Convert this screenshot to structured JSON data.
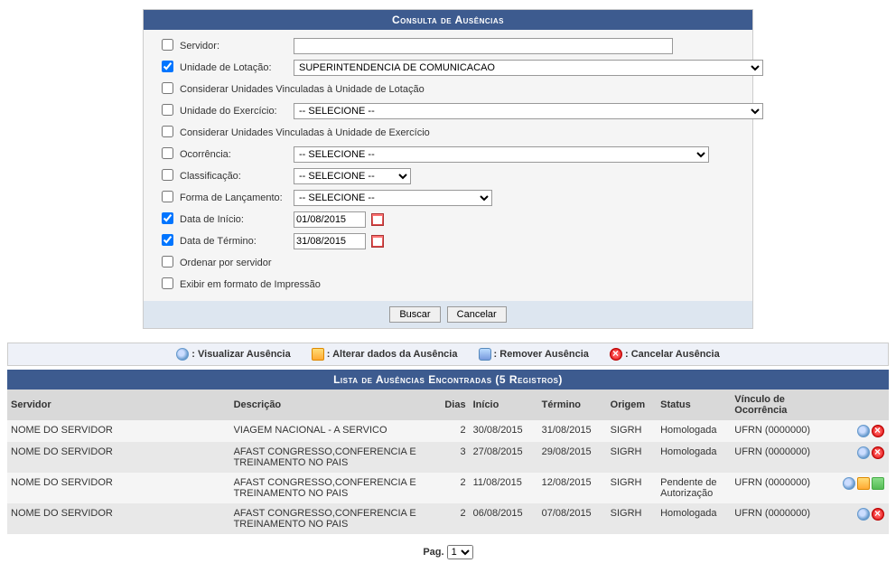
{
  "form": {
    "title": "Consulta de Ausências",
    "fields": {
      "servidor": {
        "label": "Servidor:",
        "value": "",
        "checked": false
      },
      "unidade_lotacao": {
        "label": "Unidade de Lotação:",
        "value": "SUPERINTENDENCIA DE COMUNICACAO",
        "checked": true
      },
      "considerar_lotacao": {
        "label": "Considerar Unidades Vinculadas à Unidade de Lotação",
        "checked": false
      },
      "unidade_exercicio": {
        "label": "Unidade do Exercício:",
        "value": "-- SELECIONE --",
        "checked": false
      },
      "considerar_exercicio": {
        "label": "Considerar Unidades Vinculadas à Unidade de Exercício",
        "checked": false
      },
      "ocorrencia": {
        "label": "Ocorrência:",
        "value": "-- SELECIONE --",
        "checked": false
      },
      "classificacao": {
        "label": "Classificação:",
        "value": "-- SELECIONE --",
        "checked": false
      },
      "forma_lancamento": {
        "label": "Forma de Lançamento:",
        "value": "-- SELECIONE --",
        "checked": false
      },
      "data_inicio": {
        "label": "Data de Início:",
        "value": "01/08/2015",
        "checked": true
      },
      "data_termino": {
        "label": "Data de Término:",
        "value": "31/08/2015",
        "checked": true
      },
      "ordenar_servidor": {
        "label": "Ordenar por servidor",
        "checked": false
      },
      "exibir_impressao": {
        "label": "Exibir em formato de Impressão",
        "checked": false
      }
    },
    "buttons": {
      "buscar": "Buscar",
      "cancelar": "Cancelar"
    }
  },
  "legend": {
    "view": "Visualizar Ausência",
    "edit": "Alterar dados da Ausência",
    "remove": "Remover Ausência",
    "cancel": "Cancelar Ausência"
  },
  "results": {
    "title": "Lista de Ausências Encontradas (5 Registros)",
    "headers": {
      "servidor": "Servidor",
      "descricao": "Descrição",
      "dias": "Dias",
      "inicio": "Início",
      "termino": "Término",
      "origem": "Origem",
      "status": "Status",
      "vinculo": "Vínculo de Ocorrência"
    },
    "rows": [
      {
        "servidor": "NOME DO SERVIDOR",
        "descricao": "VIAGEM NACIONAL - A SERVICO",
        "dias": "2",
        "inicio": "30/08/2015",
        "termino": "31/08/2015",
        "origem": "SIGRH",
        "status": "Homologada",
        "vinculo": "UFRN (0000000)",
        "actions": [
          "view",
          "cancel"
        ]
      },
      {
        "servidor": "NOME DO SERVIDOR",
        "descricao": "AFAST CONGRESSO,CONFERENCIA E TREINAMENTO NO PAIS",
        "dias": "3",
        "inicio": "27/08/2015",
        "termino": "29/08/2015",
        "origem": "SIGRH",
        "status": "Homologada",
        "vinculo": "UFRN (0000000)",
        "actions": [
          "view",
          "cancel"
        ]
      },
      {
        "servidor": "NOME DO SERVIDOR",
        "descricao": "AFAST CONGRESSO,CONFERENCIA E TREINAMENTO NO PAIS",
        "dias": "2",
        "inicio": "11/08/2015",
        "termino": "12/08/2015",
        "origem": "SIGRH",
        "status": "Pendente de Autorização",
        "vinculo": "UFRN (0000000)",
        "actions": [
          "view",
          "edit",
          "trash"
        ]
      },
      {
        "servidor": "NOME DO SERVIDOR",
        "descricao": "AFAST CONGRESSO,CONFERENCIA E TREINAMENTO NO PAIS",
        "dias": "2",
        "inicio": "06/08/2015",
        "termino": "07/08/2015",
        "origem": "SIGRH",
        "status": "Homologada",
        "vinculo": "UFRN (0000000)",
        "actions": [
          "view",
          "cancel"
        ]
      }
    ]
  },
  "pager": {
    "label": "Pag.",
    "value": "1"
  }
}
